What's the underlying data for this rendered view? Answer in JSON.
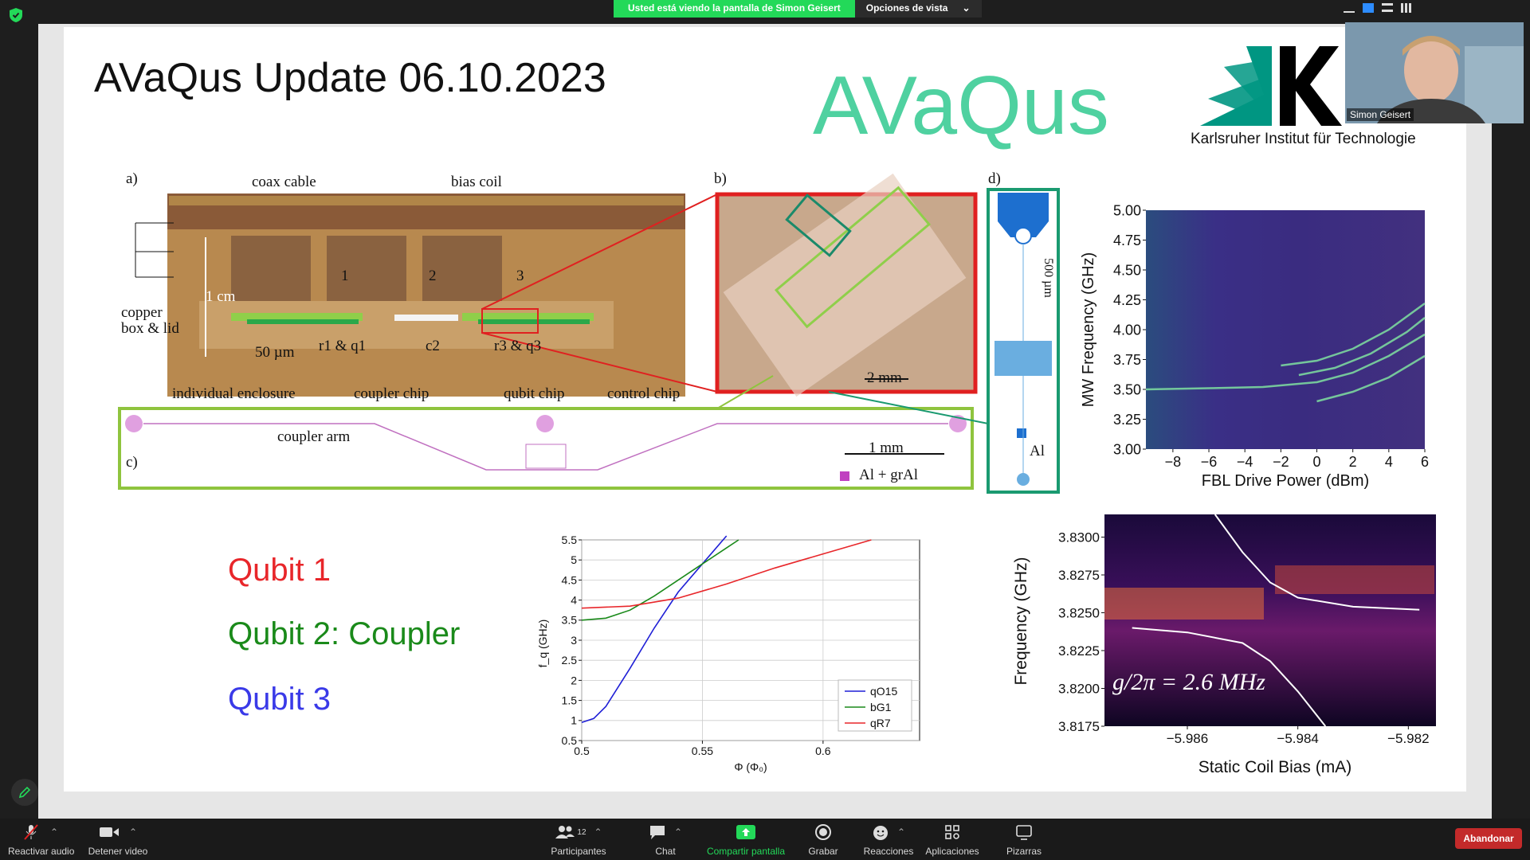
{
  "meeting": {
    "share_banner": "Usted está viendo la pantalla de Simon Geisert",
    "view_options": "Opciones de vista",
    "participant_name": "Simon Geisert",
    "participant_count": "12"
  },
  "slide": {
    "title": "AVaQus Update 06.10.2023",
    "logo_text": "AVaQus",
    "kit_name": "Karlsruher Institut für Technologie",
    "qubits": [
      {
        "label": "Qubit 1",
        "color": "#e8262a"
      },
      {
        "label": "Qubit 2: Coupler",
        "color": "#1a8a1a"
      },
      {
        "label": "Qubit 3",
        "color": "#3a3ae8"
      }
    ]
  },
  "figure": {
    "panel_a": "a)",
    "panel_b": "b)",
    "panel_c": "c)",
    "panel_d": "d)",
    "coax_cable": "coax cable",
    "bias_coil": "bias coil",
    "copper_line1": "copper",
    "copper_line2": "box & lid",
    "one_cm": "1 cm",
    "fifty_um": "50 µm",
    "r1q1": "r1 & q1",
    "c2": "c2",
    "r3q3": "r3 & q3",
    "port1": "1",
    "port2": "2",
    "port3": "3",
    "individual_enclosure": "individual enclosure",
    "coupler_chip": "coupler chip",
    "qubit_chip": "qubit chip",
    "control_chip": "control chip",
    "scale_2mm": "2 mm",
    "coupler_arm": "coupler arm",
    "scale_1mm": "1 mm",
    "al_grAl": "Al + grAl",
    "scale_500um": "500 µm",
    "al": "Al"
  },
  "chart_data": [
    {
      "type": "heatmap",
      "title": "",
      "xlabel": "FBL Drive Power (dBm)",
      "ylabel": "MW Frequency (GHz)",
      "xlim": [
        -9.5,
        6
      ],
      "ylim": [
        3.0,
        5.0
      ],
      "xticks": [
        "−8",
        "−6",
        "−4",
        "−2",
        "0",
        "2",
        "4",
        "6"
      ],
      "yticks": [
        "3.00",
        "3.25",
        "3.50",
        "3.75",
        "4.00",
        "4.25",
        "4.50",
        "4.75",
        "5.00"
      ],
      "series": [
        {
          "x": [
            -9.5,
            -6,
            -3,
            0,
            2,
            4,
            6
          ],
          "values": [
            3.5,
            3.51,
            3.52,
            3.56,
            3.64,
            3.78,
            3.96
          ]
        },
        {
          "x": [
            -2,
            0,
            2,
            4,
            6
          ],
          "values": [
            3.7,
            3.74,
            3.84,
            4.0,
            4.22
          ]
        },
        {
          "x": [
            0,
            2,
            4,
            6
          ],
          "values": [
            3.4,
            3.48,
            3.6,
            3.78
          ]
        },
        {
          "x": [
            -1,
            1,
            3,
            5,
            6
          ],
          "values": [
            3.62,
            3.68,
            3.8,
            3.98,
            4.1
          ]
        }
      ]
    },
    {
      "type": "line",
      "title": "",
      "xlabel": "Φ (Φ₀)",
      "ylabel": "f_q (GHz)",
      "xlim": [
        0.5,
        0.64
      ],
      "ylim": [
        0.5,
        5.5
      ],
      "xticks": [
        "0.5",
        "0.55",
        "0.6"
      ],
      "yticks": [
        "0.5",
        "1",
        "1.5",
        "2",
        "2.5",
        "3",
        "3.5",
        "4",
        "4.5",
        "5",
        "5.5"
      ],
      "legend": "bottom-right",
      "grid": true,
      "series": [
        {
          "name": "qO15",
          "color": "#1f1fd6",
          "x": [
            0.5,
            0.505,
            0.51,
            0.52,
            0.53,
            0.54,
            0.55,
            0.56
          ],
          "values": [
            0.95,
            1.05,
            1.35,
            2.3,
            3.3,
            4.2,
            4.9,
            5.6
          ]
        },
        {
          "name": "bG1",
          "color": "#1a8a1a",
          "x": [
            0.5,
            0.51,
            0.52,
            0.53,
            0.54,
            0.55,
            0.56,
            0.565
          ],
          "values": [
            3.5,
            3.55,
            3.75,
            4.1,
            4.5,
            4.9,
            5.3,
            5.5
          ]
        },
        {
          "name": "qR7",
          "color": "#e8262a",
          "x": [
            0.5,
            0.52,
            0.54,
            0.56,
            0.58,
            0.6,
            0.62
          ],
          "values": [
            3.8,
            3.85,
            4.05,
            4.4,
            4.8,
            5.15,
            5.5
          ]
        }
      ]
    },
    {
      "type": "heatmap",
      "title": "",
      "xlabel": "Static Coil Bias (mA)",
      "ylabel": "Frequency (GHz)",
      "xlim": [
        -5.9875,
        -5.9815
      ],
      "ylim": [
        3.8175,
        3.8315
      ],
      "xticks": [
        "−5.986",
        "−5.984",
        "−5.982"
      ],
      "yticks": [
        "3.8175",
        "3.8200",
        "3.8225",
        "3.8250",
        "3.8275",
        "3.8300"
      ],
      "annotation": "g/2π = 2.6 MHz",
      "series": [
        {
          "x": [
            -5.987,
            -5.986,
            -5.985,
            -5.9845,
            -5.984,
            -5.9835
          ],
          "values": [
            3.824,
            3.8237,
            3.823,
            3.8218,
            3.8198,
            3.8175
          ]
        },
        {
          "x": [
            -5.9855,
            -5.985,
            -5.9845,
            -5.984,
            -5.983,
            -5.9818
          ],
          "values": [
            3.8315,
            3.829,
            3.827,
            3.826,
            3.8254,
            3.8252
          ]
        }
      ]
    }
  ],
  "toolbar": {
    "mute": "Reactivar audio",
    "video": "Detener video",
    "participants": "Participantes",
    "chat": "Chat",
    "share": "Compartir pantalla",
    "record": "Grabar",
    "reactions": "Reacciones",
    "apps": "Aplicaciones",
    "whiteboards": "Pizarras",
    "leave": "Abandonar"
  }
}
